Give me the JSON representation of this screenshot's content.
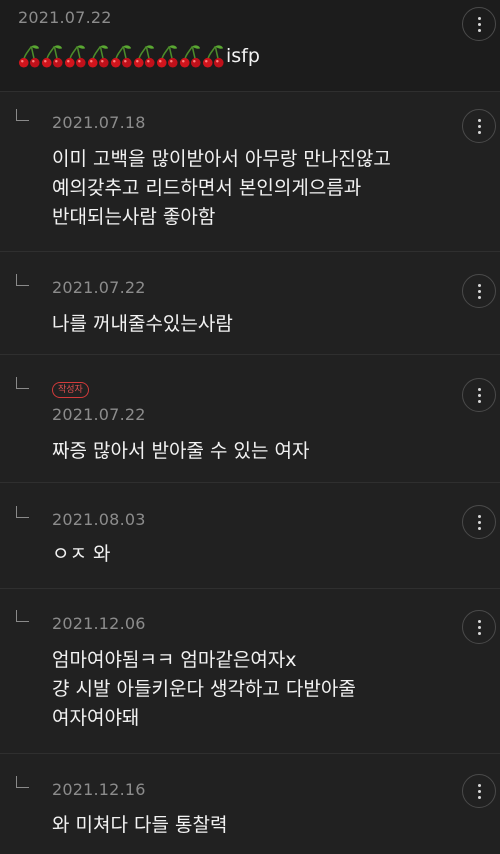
{
  "comments": [
    {
      "date": "2021.07.22",
      "text": "isfp",
      "cherry_count": 9,
      "cherry_icon": "cherries-emoji"
    },
    {
      "date": "2021.07.18",
      "text": "이미 고백을 많이받아서 아무랑 만나진않고\n예의갖추고 리드하면서 본인의게으름과\n반대되는사람 좋아함"
    },
    {
      "date": "2021.07.22",
      "text": "나를 꺼내줄수있는사람"
    },
    {
      "badge": "작성자",
      "date": "2021.07.22",
      "text": "짜증 많아서 받아줄 수 있는 여자"
    },
    {
      "date": "2021.08.03",
      "text": "ㅇㅈ 와"
    },
    {
      "date": "2021.12.06",
      "text": "엄마여야됨ㅋㅋ 엄마같은여자x\n걍 시발 아들키운다 생각하고 다받아줄\n여자여야돼"
    },
    {
      "date": "2021.12.16",
      "text": "와 미쳐다 다들 통찰력"
    }
  ],
  "colors": {
    "background": "#1c1c1c",
    "reply_background": "#212121",
    "date": "#8c8c8c",
    "text": "#f2f2f2",
    "author_badge": "#d23a3a"
  }
}
